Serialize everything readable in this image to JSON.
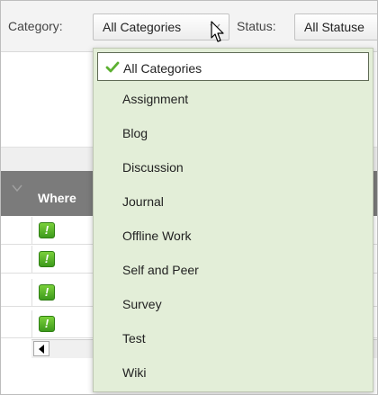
{
  "filters": {
    "category_label": "Category:",
    "category_value": "All Categories",
    "status_label": "Status:",
    "status_value": "All Statuse"
  },
  "table": {
    "header_text": "Where",
    "rows": [
      {
        "icon": "!"
      },
      {
        "icon": "!"
      },
      {
        "icon": "!"
      },
      {
        "icon": "!"
      }
    ]
  },
  "dropdown": {
    "options": [
      {
        "label": "All Categories",
        "selected": true
      },
      {
        "label": "Assignment",
        "selected": false
      },
      {
        "label": "Blog",
        "selected": false
      },
      {
        "label": "Discussion",
        "selected": false
      },
      {
        "label": "Journal",
        "selected": false
      },
      {
        "label": "Offline Work",
        "selected": false
      },
      {
        "label": "Self and Peer",
        "selected": false
      },
      {
        "label": "Survey",
        "selected": false
      },
      {
        "label": "Test",
        "selected": false
      },
      {
        "label": "Wiki",
        "selected": false
      }
    ]
  },
  "colors": {
    "dropdown_bg": "#e3eed8",
    "header_bg": "#7b7b7b",
    "check_green": "#5cb031",
    "warning_green": "#5cb82e"
  },
  "icons": {
    "check": "check-icon",
    "warning": "exclamation-icon",
    "chevron": "chevron-down-icon",
    "cursor": "mouse-pointer-icon",
    "scroll_left": "arrow-left-icon"
  }
}
